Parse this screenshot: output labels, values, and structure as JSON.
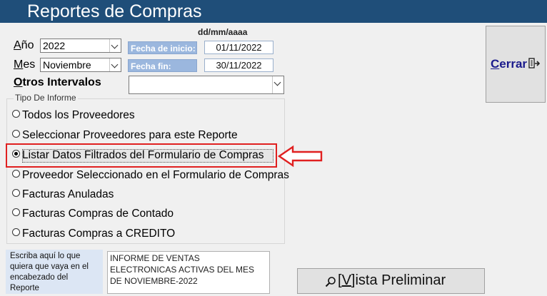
{
  "title": "Reportes de Compras",
  "date_format": "dd/mm/aaaa",
  "year": {
    "label_accel": "A",
    "label_rest": "ño",
    "value": "2022"
  },
  "month": {
    "label_accel": "M",
    "label_rest": "es",
    "value": "Noviembre"
  },
  "start_date": {
    "label": "Fecha de inicio:",
    "value": "01/11/2022"
  },
  "end_date": {
    "label": "Fecha fin:",
    "value": "30/11/2022"
  },
  "intervals": {
    "label_accel": "O",
    "label_rest": "tros Intervalos",
    "value": ""
  },
  "close_button": {
    "accel": "C",
    "rest": "errar"
  },
  "report_type": {
    "title": "Tipo De Informe",
    "options": [
      {
        "label": "Todos los Proveedores",
        "selected": false
      },
      {
        "label": "Seleccionar Proveedores para este Reporte",
        "selected": false
      },
      {
        "label": "Listar Datos Filtrados del Formulario de Compras",
        "selected": true
      },
      {
        "label": "Proveedor Seleccionado en el Formulario de Compras",
        "selected": false
      },
      {
        "label": "Facturas Anuladas",
        "selected": false
      },
      {
        "label": "Facturas Compras de Contado",
        "selected": false
      },
      {
        "label": "Facturas Compras a CREDITO",
        "selected": false
      }
    ]
  },
  "header_hint": "Escriba aquí lo que quiera que vaya en el encabezado del Reporte",
  "header_text": "INFORME DE VENTAS ELECTRONICAS ACTIVAS DEL MES DE NOVIEMBRE-2022",
  "preview_button": {
    "pre": "[",
    "accel": "V",
    "post": "]ista Preliminar"
  },
  "colors": {
    "titlebar": "#1f4e79",
    "highlight": "#e02020",
    "date_label": "#9bb7de"
  }
}
